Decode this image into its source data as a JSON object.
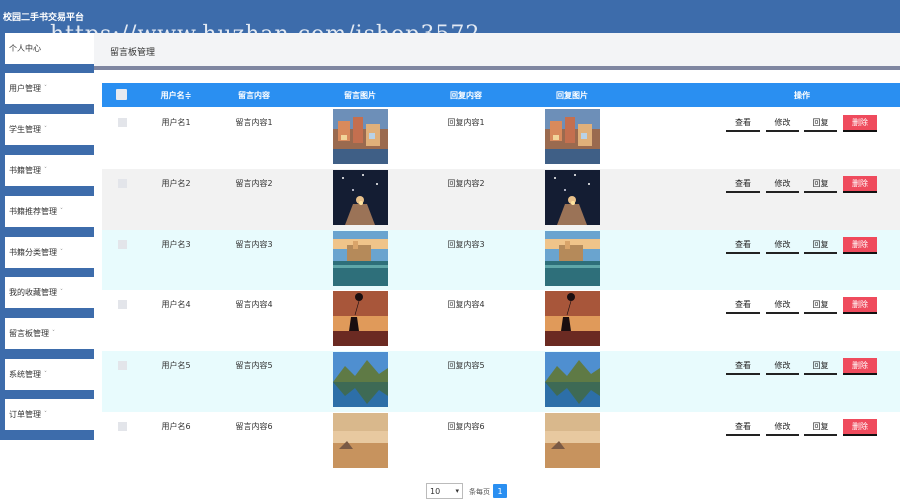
{
  "app": {
    "title": "校园二手书交易平台",
    "watermark": "https://www.huzhan.com/ishop3572"
  },
  "sidebar": {
    "items": [
      {
        "label": "个人中心",
        "arrow": ""
      },
      {
        "label": "用户管理",
        "arrow": "ˇ"
      },
      {
        "label": "学生管理",
        "arrow": "ˇ"
      },
      {
        "label": "书籍管理",
        "arrow": "ˇ"
      },
      {
        "label": "书籍推荐管理",
        "arrow": "ˇ"
      },
      {
        "label": "书籍分类管理",
        "arrow": "ˇ"
      },
      {
        "label": "我的收藏管理",
        "arrow": "ˇ"
      },
      {
        "label": "留言板管理",
        "arrow": "ˇ"
      },
      {
        "label": "系统管理",
        "arrow": "ˇ"
      },
      {
        "label": "订单管理",
        "arrow": "ˇ"
      }
    ]
  },
  "page": {
    "title": "留言板管理"
  },
  "table": {
    "headers": {
      "username": "用户名",
      "sort_icon": "≑",
      "content": "留言内容",
      "image": "留言图片",
      "reply": "回复内容",
      "reply_image": "回复图片",
      "actions": "操作"
    },
    "action_labels": {
      "view": "查看",
      "edit": "修改",
      "reply": "回复",
      "delete": "删除"
    },
    "rows": [
      {
        "username": "用户名1",
        "content": "留言内容1",
        "reply": "回复内容1",
        "image": "coastal-village-photo"
      },
      {
        "username": "用户名2",
        "content": "留言内容2",
        "reply": "回复内容2",
        "image": "starry-night-hands-photo"
      },
      {
        "username": "用户名3",
        "content": "留言内容3",
        "reply": "回复内容3",
        "image": "waterfront-castle-photo"
      },
      {
        "username": "用户名4",
        "content": "留言内容4",
        "reply": "回复内容4",
        "image": "girl-with-balloon-photo"
      },
      {
        "username": "用户名5",
        "content": "留言内容5",
        "reply": "回复内容5",
        "image": "mountain-lake-photo"
      },
      {
        "username": "用户名6",
        "content": "留言内容6",
        "reply": "回复内容6",
        "image": "desert-dusk-photo"
      }
    ]
  },
  "pagination": {
    "page_size": "10",
    "per_page_label": "条每页",
    "current_page": "1"
  },
  "colors": {
    "topbar": "#3d6cab",
    "table_header": "#2a8ff1",
    "row_alt": "#e8fbfd",
    "row_gray": "#f2f2f2",
    "delete_button": "#ef4b5d"
  }
}
